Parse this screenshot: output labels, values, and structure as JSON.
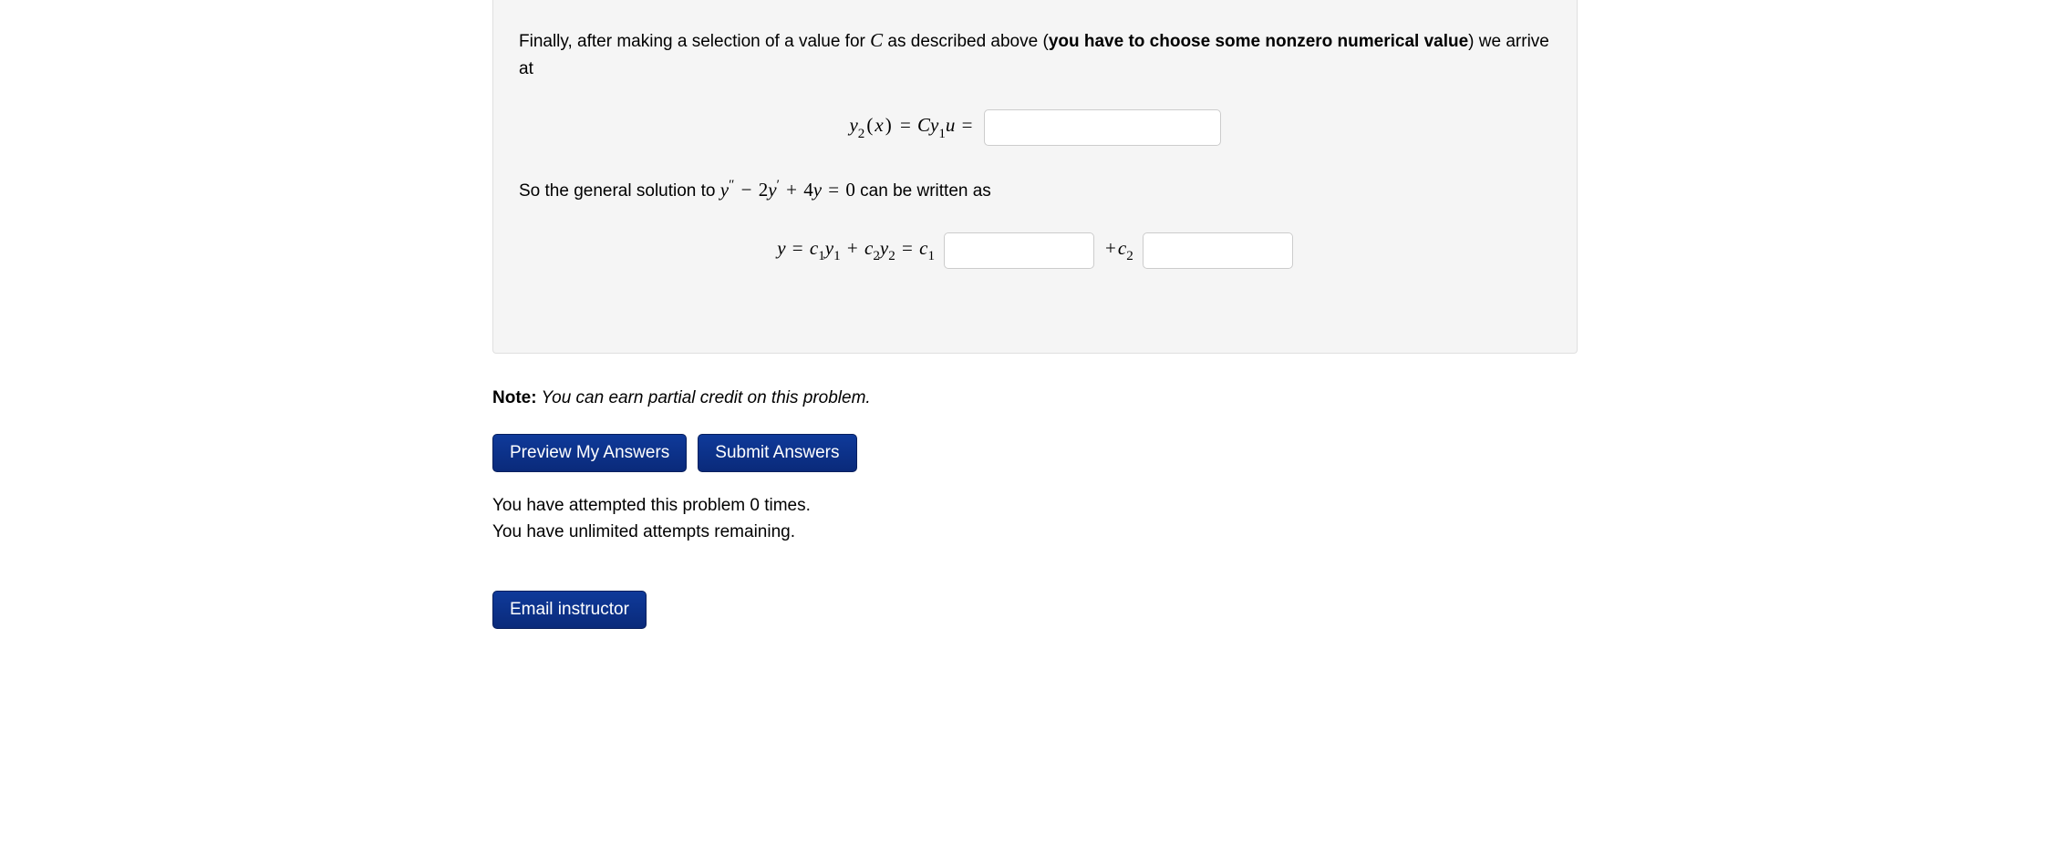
{
  "problem": {
    "intro_part1": "Finally, after making a selection of a value for ",
    "intro_C": "C",
    "intro_part2": " as described above (",
    "intro_bold": "you have to choose some nonzero numerical value",
    "intro_part3": ") we arrive at",
    "eq1_lhs": "y₂(x) = Cy₁u =",
    "mid_part1": "So the general solution to ",
    "mid_eq": "y'' − 2y' + 4y = 0",
    "mid_part2": " can be written as",
    "eq2_lhs": "y = c₁y₁ + c₂y₂ = c₁",
    "eq2_mid": "+c₂"
  },
  "note": {
    "label": "Note:",
    "text": " You can earn partial credit on this problem."
  },
  "buttons": {
    "preview": "Preview My Answers",
    "submit": "Submit Answers",
    "email": "Email instructor"
  },
  "attempts": {
    "line1": "You have attempted this problem 0 times.",
    "line2": "You have unlimited attempts remaining."
  },
  "inputs": {
    "y2_value": "",
    "c1_value": "",
    "c2_value": ""
  }
}
